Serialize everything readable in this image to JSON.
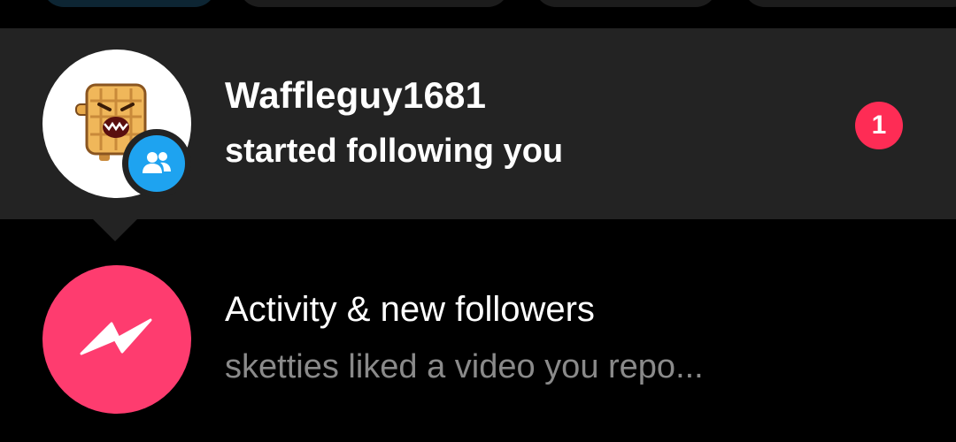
{
  "top_chips": [
    {
      "state": "active"
    },
    {
      "state": "inactive"
    },
    {
      "state": "inactive"
    },
    {
      "state": "inactive"
    }
  ],
  "notification": {
    "username": "Waffleguy1681",
    "message": "started following you",
    "count": "1",
    "avatar_icon": "waffle-character-avatar",
    "badge_icon": "followers-icon"
  },
  "activity": {
    "title": "Activity & new followers",
    "subtitle": "sketties liked a video you repo...",
    "icon": "lightning-bolt-icon"
  },
  "colors": {
    "background": "#000000",
    "card": "#232323",
    "accent_pink": "#fe2c55",
    "activity_pink": "#fe3c6f",
    "follow_blue": "#1ea3f0",
    "muted_text": "#8a8a8a"
  }
}
